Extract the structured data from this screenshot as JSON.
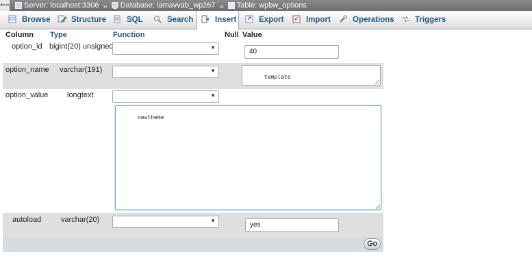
{
  "breadcrumb": {
    "server": "Server: localhost:3306",
    "database": "Database: iamavvab_wp267",
    "table": "Table: wpbw_options",
    "separator": "»"
  },
  "tabs": [
    {
      "label": "Browse",
      "icon": "browse-icon"
    },
    {
      "label": "Structure",
      "icon": "structure-icon"
    },
    {
      "label": "SQL",
      "icon": "sql-icon"
    },
    {
      "label": "Search",
      "icon": "search-icon"
    },
    {
      "label": "Insert",
      "icon": "insert-icon",
      "active": true
    },
    {
      "label": "Export",
      "icon": "export-icon"
    },
    {
      "label": "Import",
      "icon": "import-icon"
    },
    {
      "label": "Operations",
      "icon": "operations-icon"
    },
    {
      "label": "Triggers",
      "icon": "triggers-icon"
    }
  ],
  "table_header": {
    "column": "Column",
    "type": "Type",
    "function": "Function",
    "null": "Null",
    "value": "Value"
  },
  "rows": [
    {
      "column": "option_id",
      "type": "bigint(20) unsigned",
      "function": "",
      "value": "40"
    },
    {
      "column": "option_name",
      "type": "varchar(191)",
      "function": "",
      "value": "template"
    },
    {
      "column": "option_value",
      "type": "longtext",
      "function": "",
      "value": "newtheme"
    },
    {
      "column": "autoload",
      "type": "varchar(20)",
      "function": "",
      "value": "yes"
    }
  ],
  "go_label": "Go",
  "colors": {
    "tab_text": "#235a81",
    "row_alt": "#dfdfdf",
    "footer": "#d5dde3"
  }
}
